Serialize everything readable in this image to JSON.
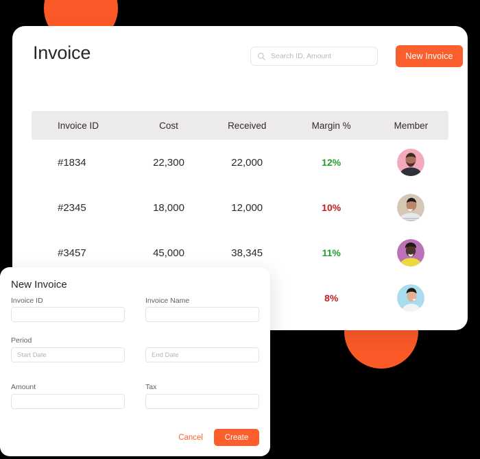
{
  "theme": {
    "accent": "#fb5f2d",
    "positive": "#22a02c",
    "negative": "#c21f1f",
    "card_bg": "#ffffff",
    "table_header_bg": "#eceaea",
    "page_bg": "#000000"
  },
  "header": {
    "title": "Invoice",
    "search": {
      "placeholder": "Search ID, Amount",
      "value": "",
      "icon": "search-icon"
    },
    "new_invoice_label": "New Invoice"
  },
  "table": {
    "columns": [
      "Invoice ID",
      "Cost",
      "Received",
      "Margin %",
      "Member"
    ],
    "rows": [
      {
        "invoice_id": "#1834",
        "cost": "22,300",
        "received": "22,000",
        "margin": "12%",
        "margin_state": "positive",
        "member_avatar": "avatar-pink"
      },
      {
        "invoice_id": "#2345",
        "cost": "18,000",
        "received": "12,000",
        "margin": "10%",
        "margin_state": "negative",
        "member_avatar": "avatar-beige"
      },
      {
        "invoice_id": "#3457",
        "cost": "45,000",
        "received": "38,345",
        "margin": "11%",
        "margin_state": "positive",
        "member_avatar": "avatar-purple"
      },
      {
        "invoice_id": "",
        "cost": "",
        "received": "",
        "margin": "8%",
        "margin_state": "negative",
        "member_avatar": "avatar-blue"
      }
    ]
  },
  "modal": {
    "title": "New Invoice",
    "fields": {
      "invoice_id": {
        "label": "Invoice ID",
        "value": "",
        "placeholder": ""
      },
      "invoice_name": {
        "label": "Invoice Name",
        "value": "",
        "placeholder": ""
      },
      "period": {
        "label": "Period"
      },
      "start_date": {
        "value": "",
        "placeholder": "Start Date"
      },
      "end_date": {
        "value": "",
        "placeholder": "End Date"
      },
      "amount": {
        "label": "Amount",
        "value": "",
        "placeholder": ""
      },
      "tax": {
        "label": "Tax",
        "value": "",
        "placeholder": ""
      }
    },
    "cancel_label": "Cancel",
    "create_label": "Create"
  }
}
